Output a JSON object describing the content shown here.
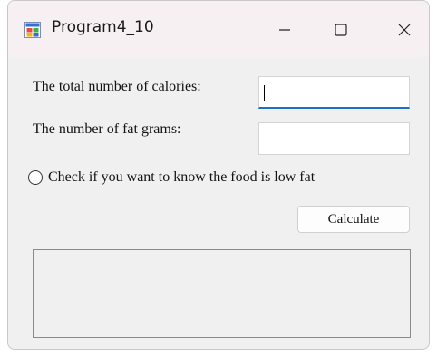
{
  "window": {
    "title": "Program4_10",
    "icon": "winforms-app-icon"
  },
  "caption_buttons": {
    "minimize": "minimize-icon",
    "maximize": "maximize-icon",
    "close": "close-icon"
  },
  "form": {
    "calories_label": "The total number of calories:",
    "calories_value": "",
    "fat_label": "The number of fat grams:",
    "fat_value": "",
    "lowfat_radio_label": "Check if you want to know the food is low fat",
    "lowfat_radio_checked": false,
    "calculate_label": "Calculate",
    "output_text": ""
  },
  "colors": {
    "focus_underline": "#1f6fc0",
    "form_background": "#f0f0f0",
    "titlebar_background": "#f7f0f2"
  }
}
